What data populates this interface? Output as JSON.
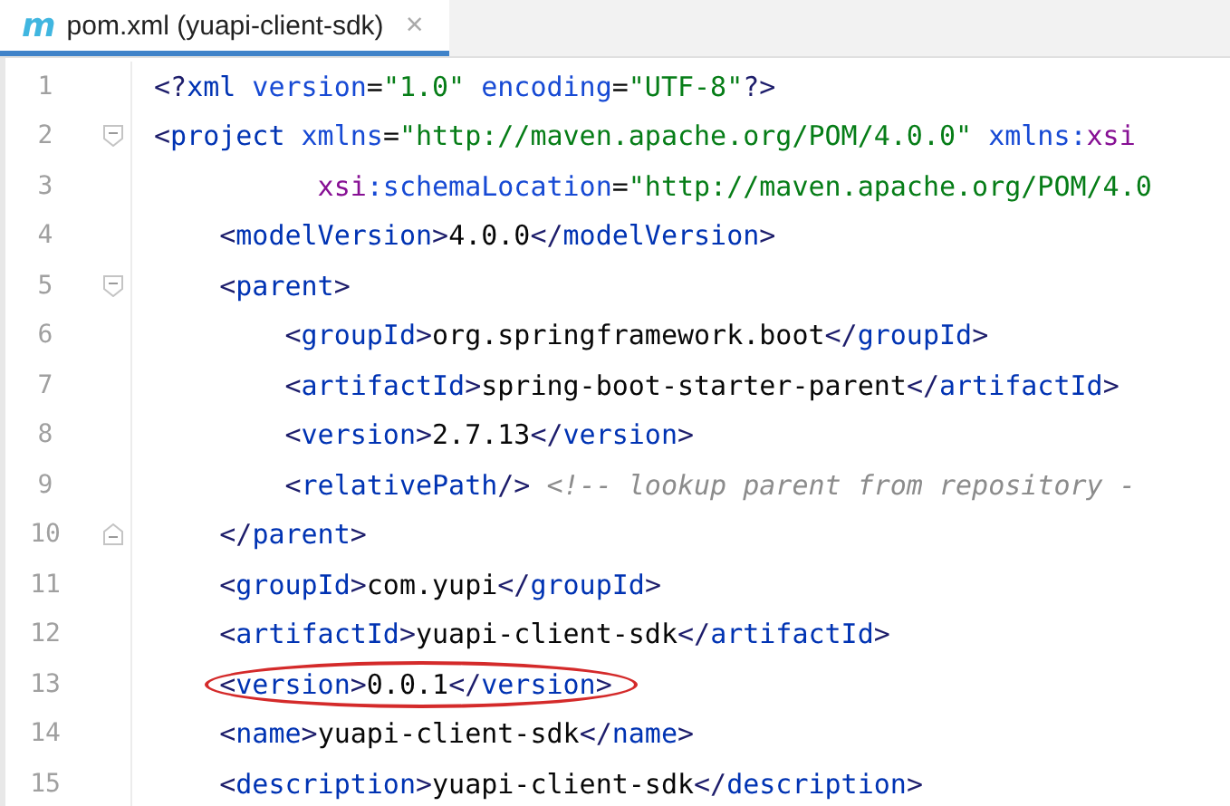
{
  "tab": {
    "icon_glyph": "m",
    "title": "pom.xml (yuapi-client-sdk)",
    "close": "×",
    "selected": true
  },
  "lines": [
    {
      "number": "1",
      "tokens": [
        {
          "kind": "bracket",
          "text": "<?"
        },
        {
          "kind": "tag",
          "text": "xml"
        },
        {
          "kind": "attr",
          "text": " version"
        },
        {
          "kind": "text",
          "text": "="
        },
        {
          "kind": "value",
          "text": "\"1.0\""
        },
        {
          "kind": "attr",
          "text": " encoding"
        },
        {
          "kind": "text",
          "text": "="
        },
        {
          "kind": "value",
          "text": "\"UTF-8\""
        },
        {
          "kind": "bracket",
          "text": "?>"
        }
      ]
    },
    {
      "number": "2",
      "fold_opener": true,
      "tokens": [
        {
          "kind": "bracket",
          "text": "<"
        },
        {
          "kind": "tag",
          "text": "project"
        },
        {
          "kind": "attr",
          "text": " xmlns"
        },
        {
          "kind": "text",
          "text": "="
        },
        {
          "kind": "value",
          "text": "\"http://maven.apache.org/POM/4.0.0\""
        },
        {
          "kind": "attr",
          "text": " xmlns:"
        },
        {
          "kind": "ns",
          "text": "xsi"
        }
      ]
    },
    {
      "number": "3",
      "continuation": true,
      "tokens": [
        {
          "kind": "ns",
          "text": "xsi"
        },
        {
          "kind": "attr",
          "text": ":schemaLocation"
        },
        {
          "kind": "text",
          "text": "="
        },
        {
          "kind": "value",
          "text": "\"http://maven.apache.org/POM/4.0"
        }
      ]
    },
    {
      "number": "4",
      "tokens": [
        {
          "kind": "bracket",
          "text": "    <"
        },
        {
          "kind": "tag",
          "text": "modelVersion"
        },
        {
          "kind": "bracket",
          "text": ">"
        },
        {
          "kind": "text",
          "text": "4.0.0"
        },
        {
          "kind": "bracket",
          "text": "</"
        },
        {
          "kind": "tag",
          "text": "modelVersion"
        },
        {
          "kind": "bracket",
          "text": ">"
        }
      ]
    },
    {
      "number": "5",
      "fold_opener": true,
      "tokens": [
        {
          "kind": "bracket",
          "text": "    <"
        },
        {
          "kind": "tag",
          "text": "parent"
        },
        {
          "kind": "bracket",
          "text": ">"
        }
      ]
    },
    {
      "number": "6",
      "tokens": [
        {
          "kind": "bracket",
          "text": "        <"
        },
        {
          "kind": "tag",
          "text": "groupId"
        },
        {
          "kind": "bracket",
          "text": ">"
        },
        {
          "kind": "text",
          "text": "org.springframework.boot"
        },
        {
          "kind": "bracket",
          "text": "</"
        },
        {
          "kind": "tag",
          "text": "groupId"
        },
        {
          "kind": "bracket",
          "text": ">"
        }
      ]
    },
    {
      "number": "7",
      "tokens": [
        {
          "kind": "bracket",
          "text": "        <"
        },
        {
          "kind": "tag",
          "text": "artifactId"
        },
        {
          "kind": "bracket",
          "text": ">"
        },
        {
          "kind": "text",
          "text": "spring-boot-starter-parent"
        },
        {
          "kind": "bracket",
          "text": "</"
        },
        {
          "kind": "tag",
          "text": "artifactId"
        },
        {
          "kind": "bracket",
          "text": ">"
        }
      ]
    },
    {
      "number": "8",
      "tokens": [
        {
          "kind": "bracket",
          "text": "        <"
        },
        {
          "kind": "tag",
          "text": "version"
        },
        {
          "kind": "bracket",
          "text": ">"
        },
        {
          "kind": "text",
          "text": "2.7.13"
        },
        {
          "kind": "bracket",
          "text": "</"
        },
        {
          "kind": "tag",
          "text": "version"
        },
        {
          "kind": "bracket",
          "text": ">"
        }
      ]
    },
    {
      "number": "9",
      "tokens": [
        {
          "kind": "bracket",
          "text": "        <"
        },
        {
          "kind": "tag",
          "text": "relativePath"
        },
        {
          "kind": "bracket",
          "text": "/>"
        },
        {
          "kind": "comment",
          "text": " <!-- lookup parent from repository -"
        }
      ]
    },
    {
      "number": "10",
      "fold_closer": true,
      "tokens": [
        {
          "kind": "bracket",
          "text": "    </"
        },
        {
          "kind": "tag",
          "text": "parent"
        },
        {
          "kind": "bracket",
          "text": ">"
        }
      ]
    },
    {
      "number": "11",
      "tokens": [
        {
          "kind": "bracket",
          "text": "    <"
        },
        {
          "kind": "tag",
          "text": "groupId"
        },
        {
          "kind": "bracket",
          "text": ">"
        },
        {
          "kind": "text",
          "text": "com.yupi"
        },
        {
          "kind": "bracket",
          "text": "</"
        },
        {
          "kind": "tag",
          "text": "groupId"
        },
        {
          "kind": "bracket",
          "text": ">"
        }
      ]
    },
    {
      "number": "12",
      "tokens": [
        {
          "kind": "bracket",
          "text": "    <"
        },
        {
          "kind": "tag",
          "text": "artifactId"
        },
        {
          "kind": "bracket",
          "text": ">"
        },
        {
          "kind": "text",
          "text": "yuapi-client-sdk"
        },
        {
          "kind": "bracket",
          "text": "</"
        },
        {
          "kind": "tag",
          "text": "artifactId"
        },
        {
          "kind": "bracket",
          "text": ">"
        }
      ]
    },
    {
      "number": "13",
      "circled": true,
      "tokens": [
        {
          "kind": "bracket",
          "text": "    <"
        },
        {
          "kind": "tag",
          "text": "version"
        },
        {
          "kind": "bracket",
          "text": ">"
        },
        {
          "kind": "text",
          "text": "0.0.1"
        },
        {
          "kind": "bracket",
          "text": "</"
        },
        {
          "kind": "tag",
          "text": "version"
        },
        {
          "kind": "bracket",
          "text": ">"
        }
      ]
    },
    {
      "number": "14",
      "tokens": [
        {
          "kind": "bracket",
          "text": "    <"
        },
        {
          "kind": "tag",
          "text": "name"
        },
        {
          "kind": "bracket",
          "text": ">"
        },
        {
          "kind": "text",
          "text": "yuapi-client-sdk"
        },
        {
          "kind": "bracket",
          "text": "</"
        },
        {
          "kind": "tag",
          "text": "name"
        },
        {
          "kind": "bracket",
          "text": ">"
        }
      ]
    },
    {
      "number": "15",
      "tokens": [
        {
          "kind": "bracket",
          "text": "    <"
        },
        {
          "kind": "tag",
          "text": "description"
        },
        {
          "kind": "bracket",
          "text": ">"
        },
        {
          "kind": "text",
          "text": "yuapi-client-sdk"
        },
        {
          "kind": "bracket",
          "text": "</"
        },
        {
          "kind": "tag",
          "text": "description"
        },
        {
          "kind": "bracket",
          "text": ">"
        }
      ]
    }
  ]
}
